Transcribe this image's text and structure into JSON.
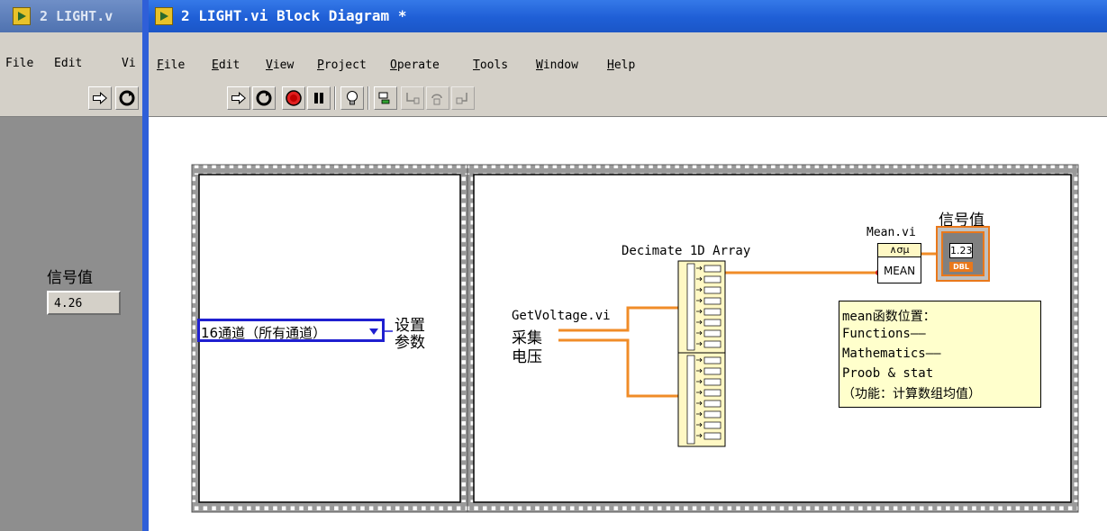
{
  "back_window": {
    "title": "2 LIGHT.v",
    "menu": [
      "File",
      "Edit",
      "Vi"
    ],
    "indicator_label": "信号值",
    "indicator_value": "4.26"
  },
  "window": {
    "title": "2 LIGHT.vi Block Diagram *"
  },
  "menu": [
    {
      "label": "File"
    },
    {
      "label": "Edit"
    },
    {
      "label": "View"
    },
    {
      "label": "Project"
    },
    {
      "label": "Operate"
    },
    {
      "label": "Tools"
    },
    {
      "label": "Window"
    },
    {
      "label": "Help"
    }
  ],
  "toolbar": {
    "icons": [
      "run-icon",
      "run-continuously-icon",
      "abort-icon",
      "pause-icon",
      "highlight-execution-icon",
      "retain-wire-values-icon",
      "step-into-icon",
      "step-over-icon",
      "step-out-icon"
    ]
  },
  "diagram": {
    "enum_value": "16通道（所有通道）",
    "enum_label_line1": "设置",
    "enum_label_line2": "参数",
    "getvoltage_label": "GetVoltage.vi",
    "collect_line1": "采集",
    "collect_line2": "电压",
    "decimate_label": "Decimate 1D Array",
    "mean_label": "Mean.vi",
    "mean_node_top": "∧σμ",
    "mean_node_bottom": "MEAN",
    "indicator_label": "信号值",
    "indicator_num": "1.23",
    "indicator_type": "DBL",
    "comment": [
      "mean函数位置：",
      "Functions——",
      "Mathematics——",
      "Proob & stat",
      "（功能：计算数组均值）"
    ]
  },
  "colors": {
    "title_bar": "#1f5fd6",
    "wire_orange": "#f08c28",
    "enum_border": "#1f1fd0",
    "comment_bg": "#ffffcc"
  }
}
